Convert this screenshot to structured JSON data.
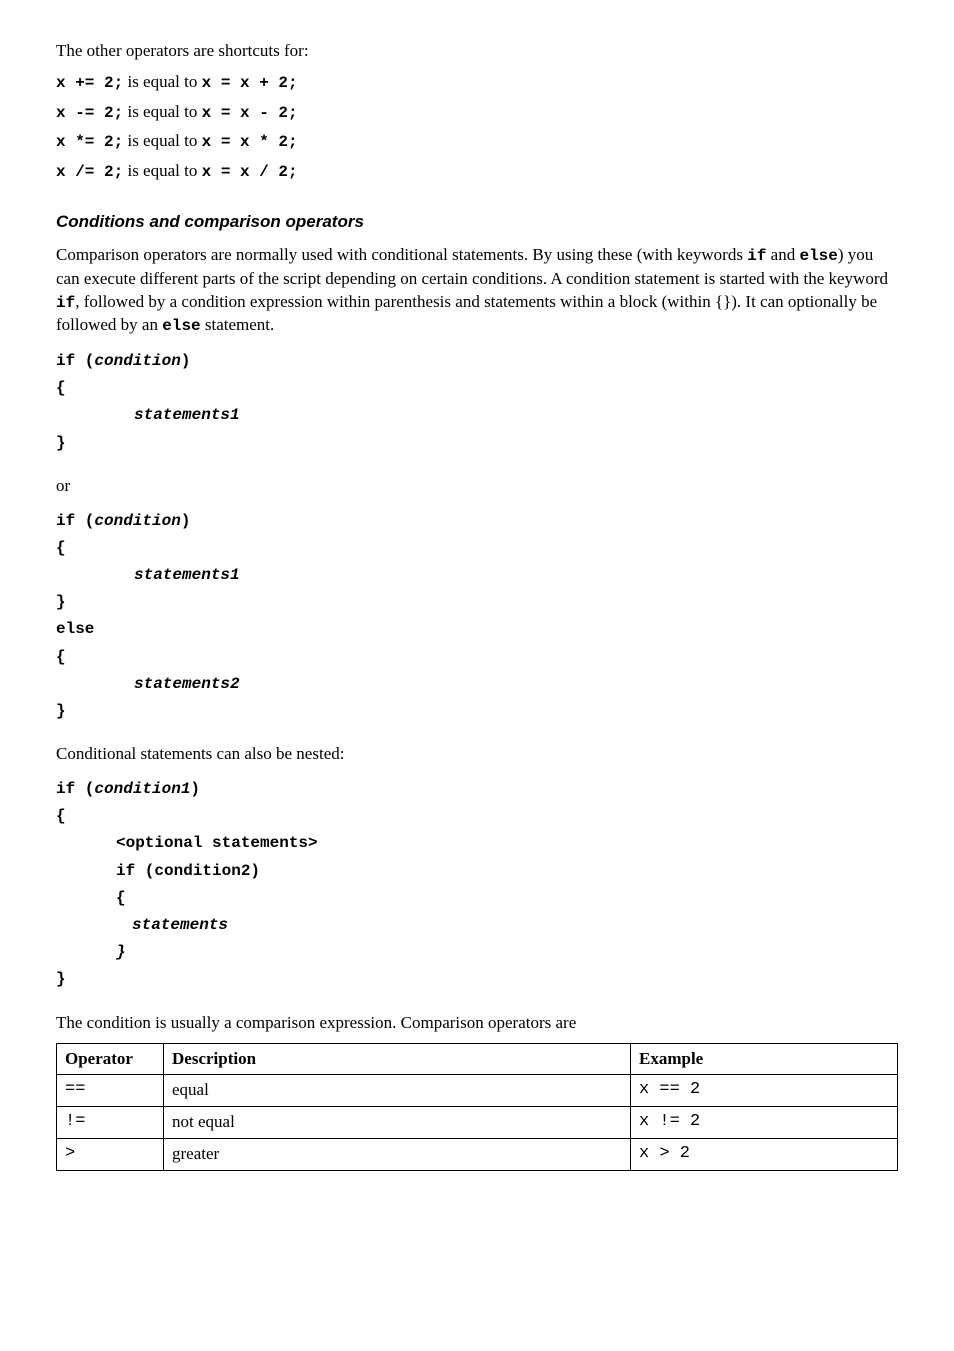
{
  "intro": "The other operators are shortcuts for:",
  "op_lines": [
    {
      "lhs": "x += 2;",
      "mid": " is equal to ",
      "rhs": "x = x + 2;"
    },
    {
      "lhs": "x -= 2;",
      "mid": " is equal to ",
      "rhs": "x = x - 2;"
    },
    {
      "lhs": "x *= 2;",
      "mid": " is equal to ",
      "rhs": "x = x * 2;"
    },
    {
      "lhs": "x /= 2;",
      "mid": " is equal to ",
      "rhs": "x = x / 2;"
    }
  ],
  "heading": "Conditions and comparison operators",
  "para1_parts": {
    "t1": "Comparison operators are normally used with conditional statements. By using these (with keywords ",
    "c1": "if",
    "t2": " and ",
    "c2": "else",
    "t3": ") you can execute different parts of the script depending on certain conditions. A condition statement is started with the keyword ",
    "c3": "if",
    "t4": ", followed by a condition expression within parenthesis and statements within a block (within {}). It can optionally be followed by an ",
    "c4": "else",
    "t5": " statement."
  },
  "block1": {
    "l1": "if (",
    "cond": "condition",
    "l1b": ")",
    "l2": "{",
    "l3": "statements1",
    "l4": "}"
  },
  "or_text": "or",
  "block2": {
    "l1": "if (",
    "cond": "condition",
    "l1b": ")",
    "l2": "{",
    "l3": "statements1",
    "l4": "}",
    "l5": "else",
    "l6": "{",
    "l7": "statements2",
    "l8": "}"
  },
  "para2": "Conditional statements can also be nested:",
  "block3": {
    "l1": "if (",
    "cond": "condition1",
    "l1b": ")",
    "l2": "{",
    "l3": "<optional statements>",
    "l4": "if (condition2)",
    "l5": "{",
    "l6": "statements",
    "l7": "}",
    "l8": "}"
  },
  "para3": "The condition is usually a comparison expression. Comparison operators are",
  "table": {
    "headers": {
      "op": "Operator",
      "desc": "Description",
      "ex": "Example"
    },
    "rows": [
      {
        "op": "==",
        "desc": "equal",
        "ex": "x == 2"
      },
      {
        "op": "!=",
        "desc": "not equal",
        "ex": "x != 2"
      },
      {
        "op": ">",
        "desc": "greater",
        "ex": "x > 2"
      }
    ]
  }
}
